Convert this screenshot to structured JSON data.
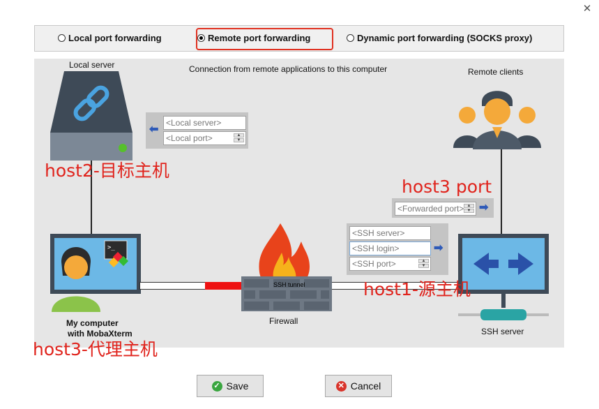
{
  "window": {
    "close_glyph": "✕"
  },
  "modes": [
    {
      "label": "Local port forwarding",
      "selected": false
    },
    {
      "label": "Remote port forwarding",
      "selected": true
    },
    {
      "label": "Dynamic port forwarding (SOCKS proxy)",
      "selected": false
    }
  ],
  "diagram": {
    "local_server_label": "Local server",
    "connection_caption": "Connection from remote applications to this computer",
    "remote_clients_label": "Remote clients",
    "my_computer_line1": "My computer",
    "my_computer_line2": "with MobaXterm",
    "firewall_label": "Firewall",
    "ssh_server_label": "SSH server",
    "tunnel_label": "SSH tunnel"
  },
  "fields": {
    "local_server": {
      "placeholder": "<Local server>"
    },
    "local_port": {
      "placeholder": "<Local port>"
    },
    "forwarded_port": {
      "placeholder": "<Forwarded port>"
    },
    "ssh_server": {
      "placeholder": "<SSH server>"
    },
    "ssh_login": {
      "placeholder": "<SSH login>"
    },
    "ssh_port": {
      "placeholder": "<SSH port>"
    }
  },
  "annotations": {
    "host2": "host2-目标主机",
    "host3_port": "host3 port",
    "host1": "host1-源主机",
    "host3": "host3-代理主机"
  },
  "buttons": {
    "save": "Save",
    "cancel": "Cancel"
  },
  "colors": {
    "annotation_red": "#e0231c",
    "highlight_red": "#e03020",
    "arrow_blue": "#2e5ab8"
  }
}
